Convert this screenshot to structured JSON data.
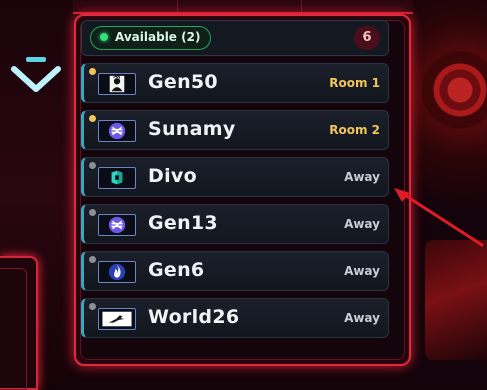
{
  "header": {
    "available_label": "Available (2)",
    "count": "6"
  },
  "colors": {
    "available_green": "#2de07a",
    "room_yellow": "#f1c55a",
    "away_gray": "#c9ccd2",
    "accent_red": "#e02a40",
    "row_accent": "#37a8c0"
  },
  "users": [
    {
      "name": "Gen50",
      "status": "Room 1",
      "state": "in-room",
      "icon": "person-silhouette-icon"
    },
    {
      "name": "Sunamy",
      "status": "Room 2",
      "state": "in-room",
      "icon": "crossed-arrows-icon"
    },
    {
      "name": "Divo",
      "status": "Away",
      "state": "away",
      "icon": "cube-logo-icon"
    },
    {
      "name": "Gen13",
      "status": "Away",
      "state": "away",
      "icon": "crossed-arrows-icon"
    },
    {
      "name": "Gen6",
      "status": "Away",
      "state": "away",
      "icon": "flame-icon"
    },
    {
      "name": "World26",
      "status": "Away",
      "state": "away",
      "icon": "bird-icon"
    }
  ],
  "decorations": {
    "left_nav_icon": "chevron-down-icon",
    "pointer": "red-arrow-icon"
  }
}
